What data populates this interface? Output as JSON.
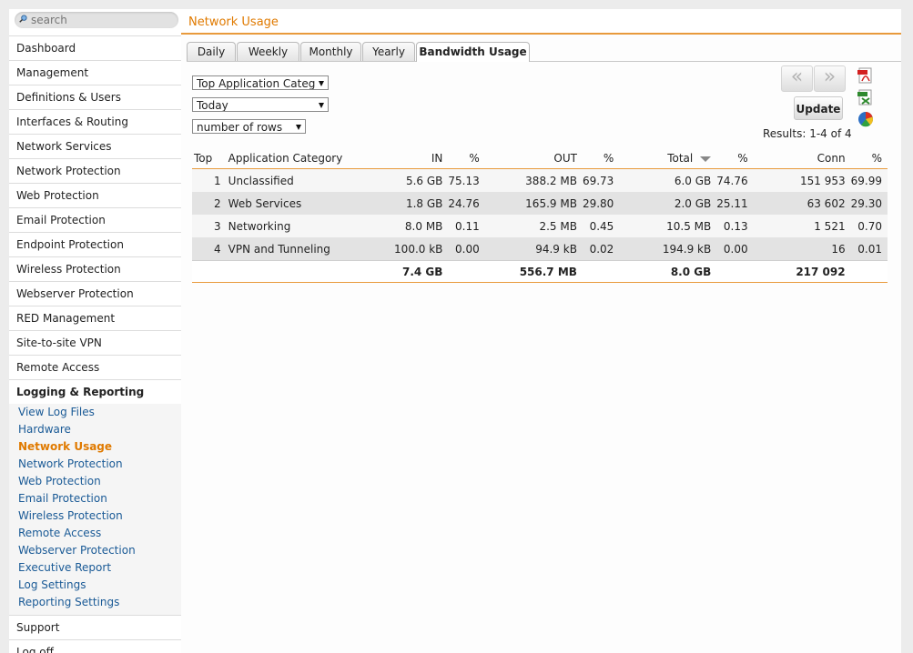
{
  "sidebar": {
    "search_placeholder": "search",
    "items": [
      {
        "label": "Dashboard"
      },
      {
        "label": "Management"
      },
      {
        "label": "Definitions & Users"
      },
      {
        "label": "Interfaces & Routing"
      },
      {
        "label": "Network Services"
      },
      {
        "label": "Network Protection"
      },
      {
        "label": "Web Protection"
      },
      {
        "label": "Email Protection"
      },
      {
        "label": "Endpoint Protection"
      },
      {
        "label": "Wireless Protection"
      },
      {
        "label": "Webserver Protection"
      },
      {
        "label": "RED Management"
      },
      {
        "label": "Site-to-site VPN"
      },
      {
        "label": "Remote Access"
      }
    ],
    "open_section": {
      "label": "Logging & Reporting",
      "subitems": [
        {
          "label": "View Log Files"
        },
        {
          "label": "Hardware"
        },
        {
          "label": "Network Usage",
          "active": true
        },
        {
          "label": "Network Protection"
        },
        {
          "label": "Web Protection"
        },
        {
          "label": "Email Protection"
        },
        {
          "label": "Wireless Protection"
        },
        {
          "label": "Remote Access"
        },
        {
          "label": "Webserver Protection"
        },
        {
          "label": "Executive Report"
        },
        {
          "label": "Log Settings"
        },
        {
          "label": "Reporting Settings"
        }
      ]
    },
    "bottom_items": [
      {
        "label": "Support"
      },
      {
        "label": "Log off"
      }
    ]
  },
  "page": {
    "title": "Network Usage"
  },
  "tabs": [
    {
      "label": "Daily"
    },
    {
      "label": "Weekly"
    },
    {
      "label": "Monthly"
    },
    {
      "label": "Yearly"
    },
    {
      "label": "Bandwidth Usage",
      "active": true
    }
  ],
  "filters": {
    "report_type": "Top Application Categories",
    "period": "Today",
    "rows": "number of rows"
  },
  "controls": {
    "prev_symbol": "«",
    "next_symbol": "»",
    "update_label": "Update",
    "results_text": "Results: 1-4 of 4"
  },
  "table": {
    "headers": {
      "top": "Top",
      "category": "Application Category",
      "in": "IN",
      "in_pct": "%",
      "out": "OUT",
      "out_pct": "%",
      "total": "Total",
      "total_pct": "%",
      "conn": "Conn",
      "conn_pct": "%"
    },
    "rows": [
      {
        "top": "1",
        "category": "Unclassified",
        "in": "5.6 GB",
        "in_pct": "75.13",
        "out": "388.2 MB",
        "out_pct": "69.73",
        "total": "6.0 GB",
        "total_pct": "74.76",
        "conn": "151 953",
        "conn_pct": "69.99"
      },
      {
        "top": "2",
        "category": "Web Services",
        "in": "1.8 GB",
        "in_pct": "24.76",
        "out": "165.9 MB",
        "out_pct": "29.80",
        "total": "2.0 GB",
        "total_pct": "25.11",
        "conn": "63 602",
        "conn_pct": "29.30"
      },
      {
        "top": "3",
        "category": "Networking",
        "in": "8.0 MB",
        "in_pct": "0.11",
        "out": "2.5 MB",
        "out_pct": "0.45",
        "total": "10.5 MB",
        "total_pct": "0.13",
        "conn": "1 521",
        "conn_pct": "0.70"
      },
      {
        "top": "4",
        "category": "VPN and Tunneling",
        "in": "100.0 kB",
        "in_pct": "0.00",
        "out": "94.9 kB",
        "out_pct": "0.02",
        "total": "194.9 kB",
        "total_pct": "0.00",
        "conn": "16",
        "conn_pct": "0.01"
      }
    ],
    "totals": {
      "in": "7.4 GB",
      "out": "556.7 MB",
      "total": "8.0 GB",
      "conn": "217 092"
    }
  },
  "colors": {
    "accent": "#e07a00",
    "link": "#1a5a96",
    "header_rule": "#e89a3c"
  },
  "icons": {
    "search": "magnifier-icon",
    "pdf_export": "pdf-icon",
    "xls_export": "xls-icon",
    "chart_view": "pie-chart-icon",
    "sort": "sort-descending-icon"
  }
}
